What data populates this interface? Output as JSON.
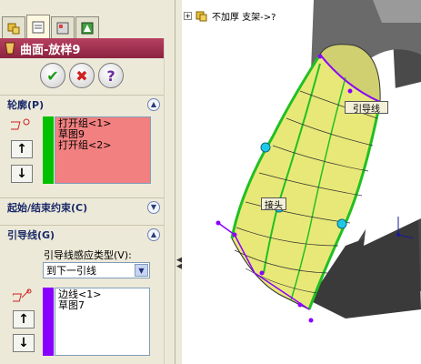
{
  "pm_title": "曲面-放样9",
  "buttons": {
    "ok": "✔",
    "cancel": "✖",
    "help": "?"
  },
  "profile_section": {
    "title": "轮廓(P)",
    "items": [
      "打开组<1>",
      "草图9",
      "打开组<2>"
    ]
  },
  "start_end_section": {
    "title": "起始/结束约束(C)"
  },
  "guide_section": {
    "title": "引导线(G)",
    "influence_label": "引导线感应类型(V):",
    "influence_value": "到下一引线",
    "items": [
      "边线<1>",
      "草图7"
    ]
  },
  "tree": {
    "item_label": "不加厚 支架->?"
  },
  "callouts": {
    "guide": "引导线",
    "connector": "接头"
  },
  "colors": {
    "header": "#8c2340",
    "profile_bg": "#f28080",
    "profile_marker": "#00c000",
    "guide_marker": "#8a00ff",
    "surface": "#e8e878"
  }
}
